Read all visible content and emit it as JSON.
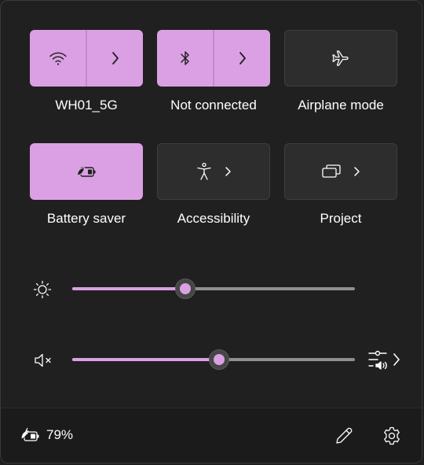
{
  "colors": {
    "accent": "#dba0e3",
    "icon_dark": "#1f1f1f",
    "icon_light": "#ffffff"
  },
  "tiles": [
    {
      "label": "WH01_5G",
      "state": "on",
      "split": true,
      "icon": "wifi-icon"
    },
    {
      "label": "Not connected",
      "state": "on",
      "split": true,
      "icon": "bluetooth-icon"
    },
    {
      "label": "Airplane mode",
      "state": "off",
      "split": false,
      "icon": "airplane-icon"
    },
    {
      "label": "Battery saver",
      "state": "on",
      "split": false,
      "icon": "battery-saver-icon"
    },
    {
      "label": "Accessibility",
      "state": "off",
      "split": false,
      "icon": "accessibility-icon"
    },
    {
      "label": "Project",
      "state": "off",
      "split": false,
      "icon": "project-icon"
    }
  ],
  "sliders": {
    "brightness": {
      "icon": "brightness-icon",
      "value": 40
    },
    "volume": {
      "icon": "speaker-muted-icon",
      "value": 52
    }
  },
  "audio_output": {
    "icon": "audio-output-icon"
  },
  "footer": {
    "battery_percent": "79%",
    "battery_icon": "battery-charging-saver-icon",
    "edit_icon": "pencil-icon",
    "settings_icon": "gear-icon"
  }
}
